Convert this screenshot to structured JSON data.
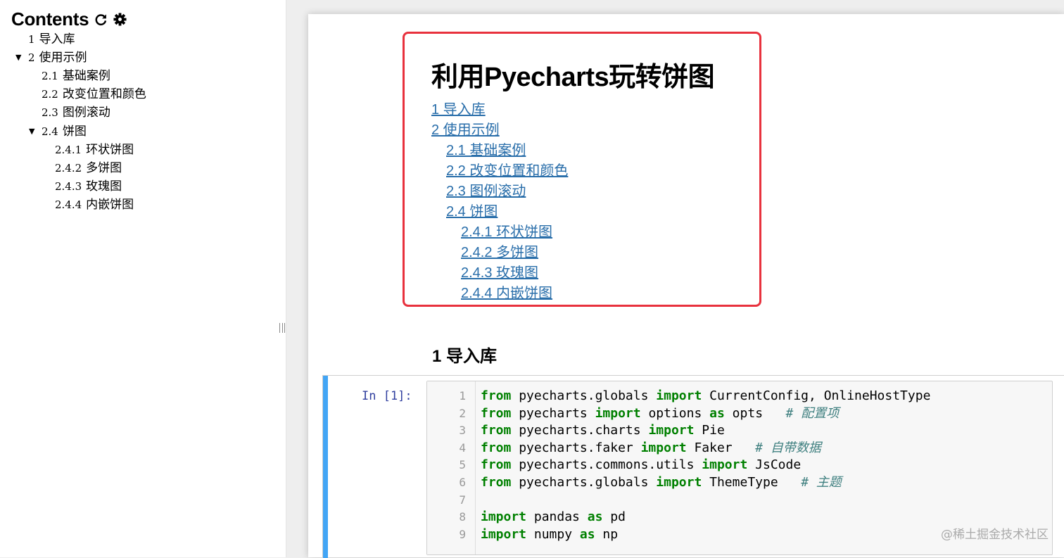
{
  "sidebar": {
    "title": "Contents",
    "icons": [
      "refresh-icon",
      "gear-icon"
    ],
    "items": [
      {
        "num": "1",
        "label": "导入库"
      },
      {
        "num": "2",
        "label": "使用示例",
        "expanded": true
      },
      {
        "num": "2.1",
        "label": "基础案例"
      },
      {
        "num": "2.2",
        "label": "改变位置和颜色"
      },
      {
        "num": "2.3",
        "label": "图例滚动"
      },
      {
        "num": "2.4",
        "label": "饼图",
        "expanded": true
      },
      {
        "num": "2.4.1",
        "label": "环状饼图"
      },
      {
        "num": "2.4.2",
        "label": "多饼图"
      },
      {
        "num": "2.4.3",
        "label": "玫瑰图"
      },
      {
        "num": "2.4.4",
        "label": "内嵌饼图"
      }
    ]
  },
  "notebook": {
    "title": "利用Pyecharts玩转饼图",
    "toc_links": [
      "1  导入库",
      "2  使用示例",
      "2.1  基础案例",
      "2.2  改变位置和颜色",
      "2.3  图例滚动",
      "2.4  饼图",
      "2.4.1  环状饼图",
      "2.4.2  多饼图",
      "2.4.3  玫瑰图",
      "2.4.4  内嵌饼图"
    ],
    "section_heading": "1  导入库",
    "cell": {
      "prompt": "In [1]:",
      "line_numbers": [
        "1",
        "2",
        "3",
        "4",
        "5",
        "6",
        "7",
        "8",
        "9"
      ],
      "lines": [
        [
          {
            "t": "from",
            "k": "kw"
          },
          {
            "t": " pyecharts.globals "
          },
          {
            "t": "import",
            "k": "kw"
          },
          {
            "t": " CurrentConfig, OnlineHostType"
          }
        ],
        [
          {
            "t": "from",
            "k": "kw"
          },
          {
            "t": " pyecharts "
          },
          {
            "t": "import",
            "k": "kw"
          },
          {
            "t": " options "
          },
          {
            "t": "as",
            "k": "kw"
          },
          {
            "t": " opts   "
          },
          {
            "t": "# 配置项",
            "k": "cm"
          }
        ],
        [
          {
            "t": "from",
            "k": "kw"
          },
          {
            "t": " pyecharts.charts "
          },
          {
            "t": "import",
            "k": "kw"
          },
          {
            "t": " Pie"
          }
        ],
        [
          {
            "t": "from",
            "k": "kw"
          },
          {
            "t": " pyecharts.faker "
          },
          {
            "t": "import",
            "k": "kw"
          },
          {
            "t": " Faker   "
          },
          {
            "t": "# 自带数据",
            "k": "cm"
          }
        ],
        [
          {
            "t": "from",
            "k": "kw"
          },
          {
            "t": " pyecharts.commons.utils "
          },
          {
            "t": "import",
            "k": "kw"
          },
          {
            "t": " JsCode"
          }
        ],
        [
          {
            "t": "from",
            "k": "kw"
          },
          {
            "t": " pyecharts.globals "
          },
          {
            "t": "import",
            "k": "kw"
          },
          {
            "t": " ThemeType   "
          },
          {
            "t": "# 主题",
            "k": "cm"
          }
        ],
        [],
        [
          {
            "t": "import",
            "k": "kw"
          },
          {
            "t": " pandas "
          },
          {
            "t": "as",
            "k": "kw"
          },
          {
            "t": " pd"
          }
        ],
        [
          {
            "t": "import",
            "k": "kw"
          },
          {
            "t": " numpy "
          },
          {
            "t": "as",
            "k": "kw"
          },
          {
            "t": " np"
          }
        ]
      ]
    }
  },
  "watermark": "@稀土掘金技术社区",
  "colors": {
    "link": "#296eaa",
    "highlight_border": "#e8313d",
    "cell_bar": "#42a5f5",
    "keyword": "#008000",
    "comment": "#408080",
    "prompt": "#303f9f"
  }
}
